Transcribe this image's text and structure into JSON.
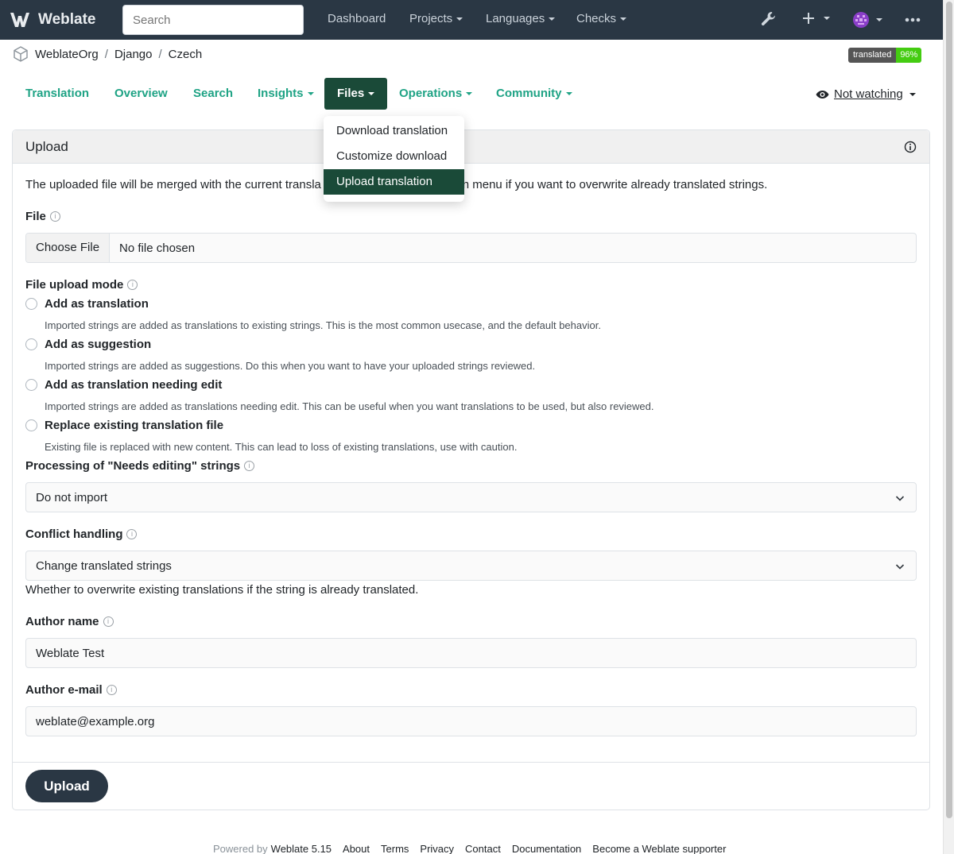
{
  "navbar": {
    "brand": "Weblate",
    "search_placeholder": "Search",
    "items": [
      "Dashboard",
      "Projects",
      "Languages",
      "Checks"
    ]
  },
  "breadcrumb": [
    "WeblateOrg",
    "Django",
    "Czech"
  ],
  "progress": {
    "label": "translated",
    "value": "96%"
  },
  "subnav": {
    "items": [
      "Translation",
      "Overview",
      "Search",
      "Insights",
      "Files",
      "Operations",
      "Community"
    ],
    "active": "Files",
    "watch": "Not watching"
  },
  "dropdown": {
    "items": [
      "Download translation",
      "Customize download",
      "Upload translation"
    ],
    "active": "Upload translation"
  },
  "upload": {
    "title": "Upload",
    "description": "The uploaded file will be merged with the current translation. Use the dropdown menu if you want to overwrite already translated strings.",
    "description_visible_left": "The uploaded file will be merged with the current transla",
    "description_visible_right": "pdown menu if you want to overwrite already translated strings.",
    "file_label": "File",
    "file_button": "Choose File",
    "file_status": "No file chosen",
    "mode_label": "File upload mode",
    "modes": [
      {
        "label": "Add as translation",
        "help": "Imported strings are added as translations to existing strings. This is the most common usecase, and the default behavior."
      },
      {
        "label": "Add as suggestion",
        "help": "Imported strings are added as suggestions. Do this when you want to have your uploaded strings reviewed."
      },
      {
        "label": "Add as translation needing edit",
        "help": "Imported strings are added as translations needing edit. This can be useful when you want translations to be used, but also reviewed."
      },
      {
        "label": "Replace existing translation file",
        "help": "Existing file is replaced with new content. This can lead to loss of existing translations, use with caution."
      }
    ],
    "fuzzy_label": "Processing of \"Needs editing\" strings",
    "fuzzy_value": "Do not import",
    "conflict_label": "Conflict handling",
    "conflict_value": "Change translated strings",
    "conflict_help": "Whether to overwrite existing translations if the string is already translated.",
    "author_name_label": "Author name",
    "author_name_value": "Weblate Test",
    "author_email_label": "Author e-mail",
    "author_email_value": "weblate@example.org",
    "submit": "Upload"
  },
  "footer": {
    "powered_by": "Powered by",
    "version": "Weblate 5.15",
    "links": [
      "About",
      "Terms",
      "Privacy",
      "Contact",
      "Documentation",
      "Become a Weblate supporter"
    ]
  },
  "colors": {
    "navbar": "#2a3744",
    "accent": "#1fa385",
    "active": "#1a4a38",
    "progress": "#44cc11"
  }
}
